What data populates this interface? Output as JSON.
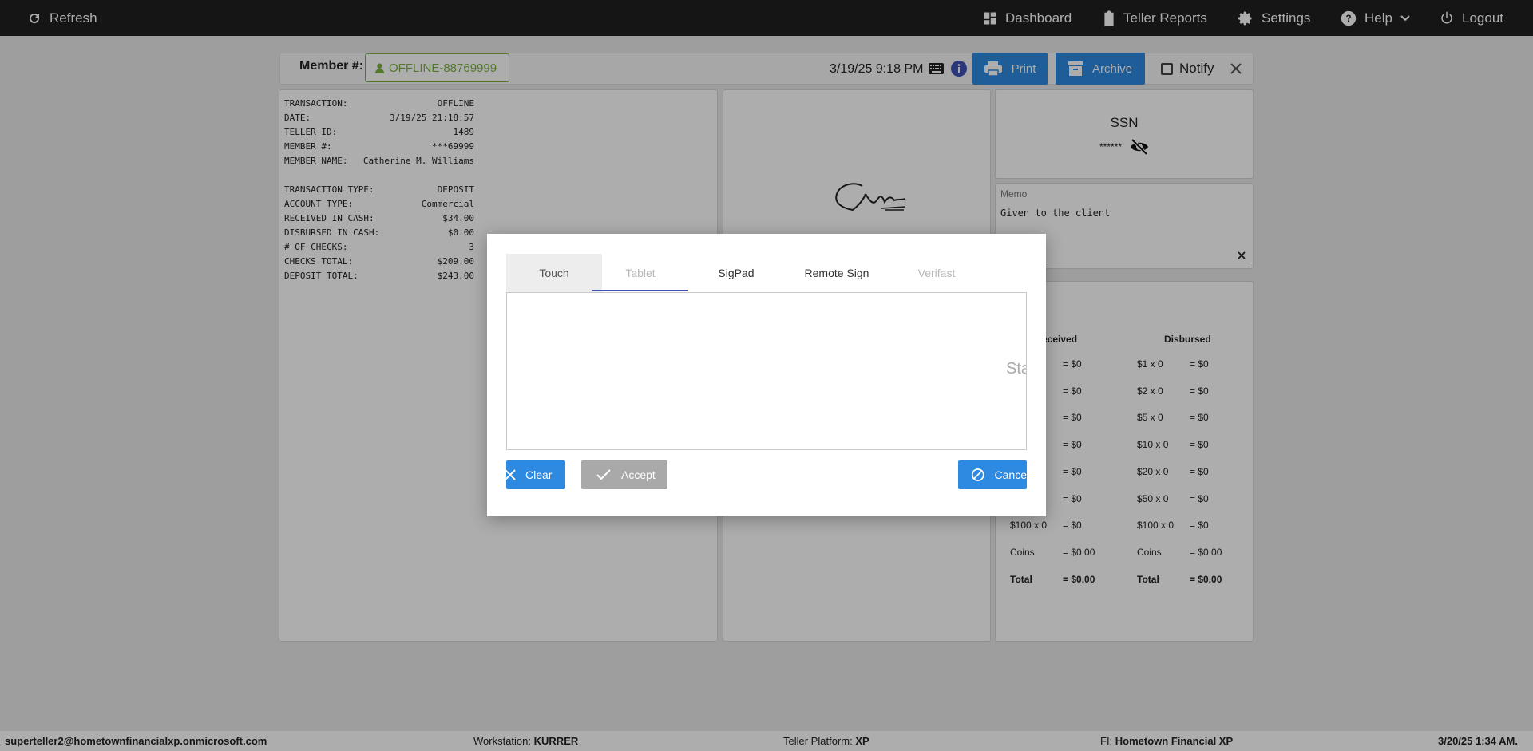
{
  "topbar": {
    "refresh": "Refresh",
    "dashboard": "Dashboard",
    "teller_reports": "Teller Reports",
    "settings": "Settings",
    "help": "Help",
    "logout": "Logout"
  },
  "header": {
    "member_label": "Member #:",
    "member_number": "OFFLINE-88769999",
    "datetime": "3/19/25 9:18 PM",
    "print": "Print",
    "archive": "Archive",
    "notify": "Notify"
  },
  "receipt": {
    "rows1": [
      {
        "k": "TRANSACTION:",
        "v": "OFFLINE"
      },
      {
        "k": "DATE:",
        "v": "3/19/25 21:18:57"
      },
      {
        "k": "TELLER ID:",
        "v": "1489"
      },
      {
        "k": "MEMBER #:",
        "v": "***69999"
      },
      {
        "k": "MEMBER NAME:",
        "v": "Catherine M. Williams"
      }
    ],
    "rows2": [
      {
        "k": "TRANSACTION TYPE:",
        "v": "DEPOSIT"
      },
      {
        "k": "ACCOUNT TYPE:",
        "v": "Commercial"
      },
      {
        "k": "RECEIVED IN CASH:",
        "v": "$34.00"
      },
      {
        "k": "DISBURSED IN CASH:",
        "v": "$0.00"
      },
      {
        "k": "# OF CHECKS:",
        "v": "3"
      },
      {
        "k": "CHECKS TOTAL:",
        "v": "$209.00"
      },
      {
        "k": "DEPOSIT TOTAL:",
        "v": "$243.00"
      }
    ]
  },
  "ssn": {
    "title": "SSN",
    "masked": "******"
  },
  "memo": {
    "label": "Memo",
    "text": "Given to the client"
  },
  "cash": {
    "received_header": "eceived",
    "disbursed_header": "Disbursed",
    "rows": [
      {
        "rl": "",
        "rv": "= $0",
        "dl": "$1 x 0",
        "dv": "= $0"
      },
      {
        "rl": "",
        "rv": "= $0",
        "dl": "$2 x 0",
        "dv": "= $0"
      },
      {
        "rl": "",
        "rv": "= $0",
        "dl": "$5 x 0",
        "dv": "= $0"
      },
      {
        "rl": "",
        "rv": "= $0",
        "dl": "$10 x 0",
        "dv": "= $0"
      },
      {
        "rl": "",
        "rv": "= $0",
        "dl": "$20 x 0",
        "dv": "= $0"
      },
      {
        "rl": "",
        "rv": "= $0",
        "dl": "$50 x 0",
        "dv": "= $0"
      },
      {
        "rl": "$100 x 0",
        "rv": "= $0",
        "dl": "$100 x 0",
        "dv": "= $0"
      },
      {
        "rl": "Coins",
        "rv": "= $0.00",
        "dl": "Coins",
        "dv": "= $0.00"
      },
      {
        "rl": "Total",
        "rv": "= $0.00",
        "dl": "Total",
        "dv": "= $0.00"
      }
    ]
  },
  "footer": {
    "user": "superteller2@hometownfinancialxp.onmicrosoft.com",
    "workstation_label": "Workstation:",
    "workstation": "KURRER",
    "platform_label": "Teller Platform:",
    "platform": "XP",
    "fi_label": "FI:",
    "fi": "Hometown Financial XP",
    "timestamp": "3/20/25 1:34 AM."
  },
  "modal": {
    "tabs": [
      "Touch",
      "Tablet",
      "SigPad",
      "Remote Sign",
      "Verifast"
    ],
    "hint": "Sta",
    "clear": "Clear",
    "accept": "Accept",
    "cancel": "Cance"
  },
  "colors": {
    "primary": "#2d8ae0",
    "member_green": "#7cb342",
    "topbar": "#1f1f1f",
    "tab_underline": "#3f51b5"
  }
}
